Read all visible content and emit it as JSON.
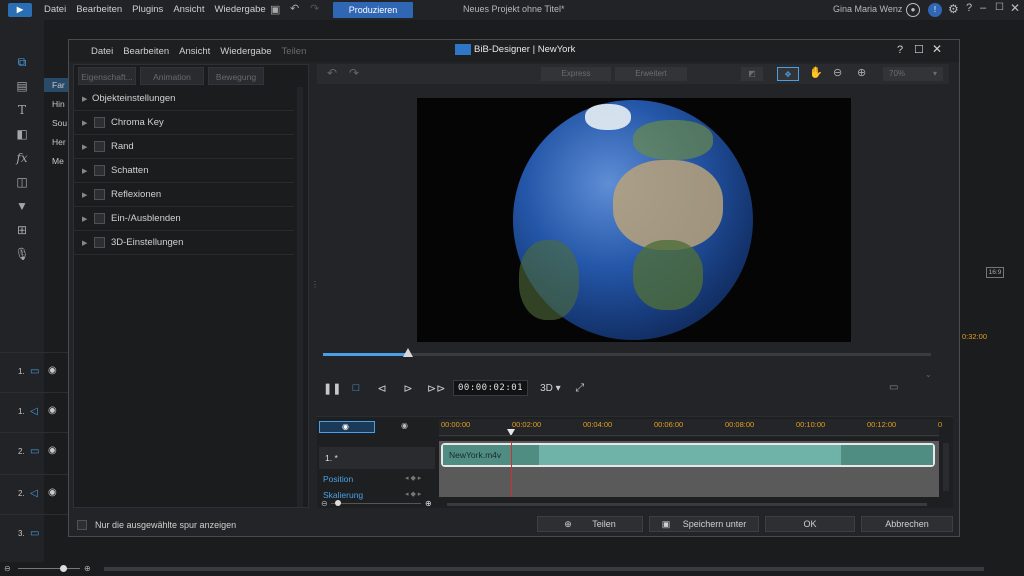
{
  "app": {
    "menu": [
      "Datei",
      "Bearbeiten",
      "Plugins",
      "Ansicht",
      "Wiedergabe"
    ],
    "produce_label": "Produzieren",
    "project_title": "Neues Projekt ohne Titel*",
    "user_name": "Gina Maria Wenz"
  },
  "background": {
    "left_labels": [
      "Far",
      "Hin",
      "Sou",
      "Her",
      "Me"
    ],
    "tracks": [
      "1.",
      "1.",
      "2.",
      "2.",
      "3."
    ],
    "aspect_label": "16:9",
    "time_label": "0:32:00"
  },
  "dialog": {
    "menu": [
      "Datei",
      "Bearbeiten",
      "Ansicht",
      "Wiedergabe",
      "Teilen"
    ],
    "title": "BiB-Designer | NewYork",
    "tabs": [
      "Eigenschaft...",
      "Animation",
      "Bewegung"
    ],
    "properties": [
      {
        "label": "Objekteinstellungen",
        "checkbox": false
      },
      {
        "label": "Chroma Key",
        "checkbox": true
      },
      {
        "label": "Rand",
        "checkbox": true
      },
      {
        "label": "Schatten",
        "checkbox": true
      },
      {
        "label": "Reflexionen",
        "checkbox": true
      },
      {
        "label": "Ein-/Ausblenden",
        "checkbox": true
      },
      {
        "label": "3D-Einstellungen",
        "checkbox": true
      }
    ],
    "toolbar": {
      "express_label": "Express",
      "advanced_label": "Erweitert",
      "zoom": "70%"
    },
    "player": {
      "timecode": "00:00:02:01",
      "mode_3d": "3D",
      "progress": 0.14
    },
    "timeline": {
      "ticks": [
        "00:00:00",
        "00:02:00",
        "00:04:00",
        "00:06:00",
        "00:08:00",
        "00:10:00",
        "00:12:00",
        "0"
      ],
      "track_name": "1. *",
      "clip_name": "NewYork.m4v",
      "sub_tracks": [
        "Position",
        "Skalierung"
      ]
    },
    "footer": {
      "only_selected": "Nur die ausgewählte spur anzeigen",
      "share": "Teilen",
      "save_as": "Speichern unter",
      "ok": "OK",
      "cancel": "Abbrechen"
    }
  }
}
